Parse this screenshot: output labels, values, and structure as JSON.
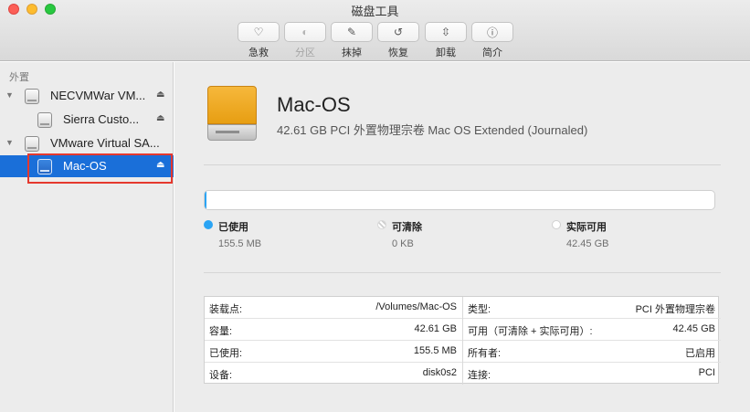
{
  "window": {
    "title": "磁盘工具"
  },
  "toolbar": {
    "items": [
      {
        "label": "急救",
        "icon": "first-aid-icon",
        "glyph": "♡",
        "enabled": true
      },
      {
        "label": "分区",
        "icon": "partition-icon",
        "glyph": "◐",
        "enabled": false
      },
      {
        "label": "抹掉",
        "icon": "erase-icon",
        "glyph": "✎",
        "enabled": true
      },
      {
        "label": "恢复",
        "icon": "restore-icon",
        "glyph": "↺",
        "enabled": true
      },
      {
        "label": "卸载",
        "icon": "unmount-icon",
        "glyph": "⇳",
        "enabled": true
      },
      {
        "label": "简介",
        "icon": "info-icon",
        "glyph": "ⓘ",
        "enabled": true
      }
    ]
  },
  "sidebar": {
    "heading": "外置",
    "items": [
      {
        "label": "NECVMWar VM...",
        "eject": "⏏"
      },
      {
        "label": "Sierra Custo...",
        "eject": "⏏"
      },
      {
        "label": "VMware Virtual SA...",
        "eject": ""
      },
      {
        "label": "Mac-OS",
        "eject": "⏏"
      }
    ]
  },
  "volume": {
    "name": "Mac-OS",
    "subtitle": "42.61 GB PCI 外置物理宗卷 Mac OS Extended (Journaled)"
  },
  "usage": {
    "used_fraction": 0.0036,
    "fill_color": "#2aa4f4",
    "legend": [
      {
        "title": "已使用",
        "value": "155.5 MB",
        "color": "#2aa4f4"
      },
      {
        "title": "可清除",
        "value": "0 KB",
        "color": "#ffffff"
      },
      {
        "title": "实际可用",
        "value": "42.45 GB",
        "color": "#ffffff"
      }
    ]
  },
  "info": {
    "left": [
      {
        "key": "装载点:",
        "value": "/Volumes/Mac-OS"
      },
      {
        "key": "容量:",
        "value": "42.61 GB"
      },
      {
        "key": "已使用:",
        "value": "155.5 MB"
      },
      {
        "key": "设备:",
        "value": "disk0s2"
      }
    ],
    "right": [
      {
        "key": "类型:",
        "value": "PCI 外置物理宗卷"
      },
      {
        "key": "可用（可清除 + 实际可用）:",
        "value": "42.45 GB"
      },
      {
        "key": "所有者:",
        "value": "已启用"
      },
      {
        "key": "连接:",
        "value": "PCI"
      }
    ]
  },
  "colors": {
    "selection": "#1a6fd9",
    "highlight_outline": "#e5382e"
  }
}
